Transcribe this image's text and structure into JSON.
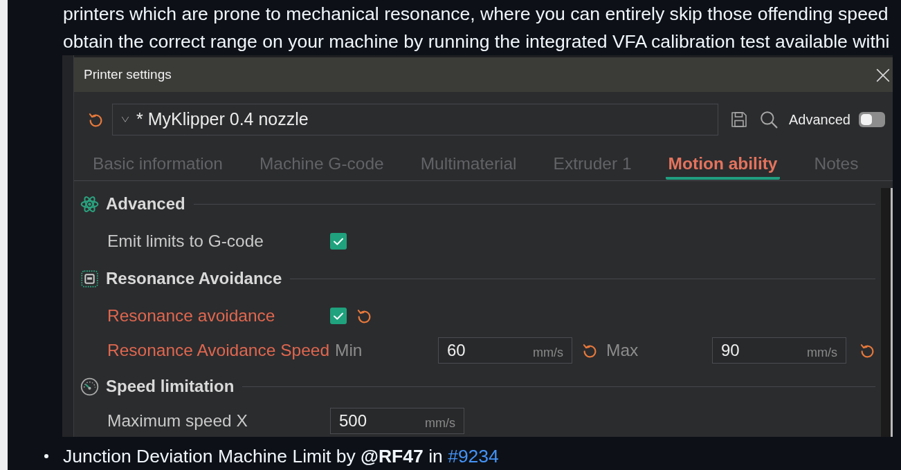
{
  "article": {
    "text_lines": [
      "printers which are prone to mechanical resonance, where you can entirely skip those offending speed",
      "obtain the correct range on your machine by running the integrated VFA calibration test available withi"
    ],
    "screenshot": {
      "dialog": {
        "title": "Printer settings",
        "preset": {
          "value": "* MyKlipper 0.4 nozzle",
          "modified": true
        },
        "advanced": {
          "label": "Advanced",
          "on": false
        },
        "tabs": [
          {
            "label": "Basic information",
            "selected": false
          },
          {
            "label": "Machine G-code",
            "selected": false
          },
          {
            "label": "Multimaterial",
            "selected": false
          },
          {
            "label": "Extruder 1",
            "selected": false
          },
          {
            "label": "Motion ability",
            "selected": true
          },
          {
            "label": "Notes",
            "selected": false
          }
        ],
        "sections": [
          {
            "title": "Advanced",
            "rows": [
              {
                "kind": "checkbox",
                "label": "Emit limits to G-code",
                "checked": true,
                "modified": false
              }
            ]
          },
          {
            "title": "Resonance Avoidance",
            "rows": [
              {
                "kind": "checkbox",
                "label": "Resonance avoidance",
                "checked": true,
                "modified": true
              },
              {
                "kind": "range",
                "label": "Resonance Avoidance Speed",
                "modified": true,
                "min": {
                  "label": "Min",
                  "value": "60",
                  "unit": "mm/s"
                },
                "max": {
                  "label": "Max",
                  "value": "90",
                  "unit": "mm/s"
                }
              }
            ]
          },
          {
            "title": "Speed limitation",
            "rows": [
              {
                "kind": "number",
                "label": "Maximum speed X",
                "value": "500",
                "unit": "mm/s",
                "modified": false
              }
            ]
          }
        ]
      }
    },
    "list_items": [
      {
        "text": "Junction Deviation Machine Limit by **@RF47** in",
        "link": "#9234"
      }
    ]
  }
}
